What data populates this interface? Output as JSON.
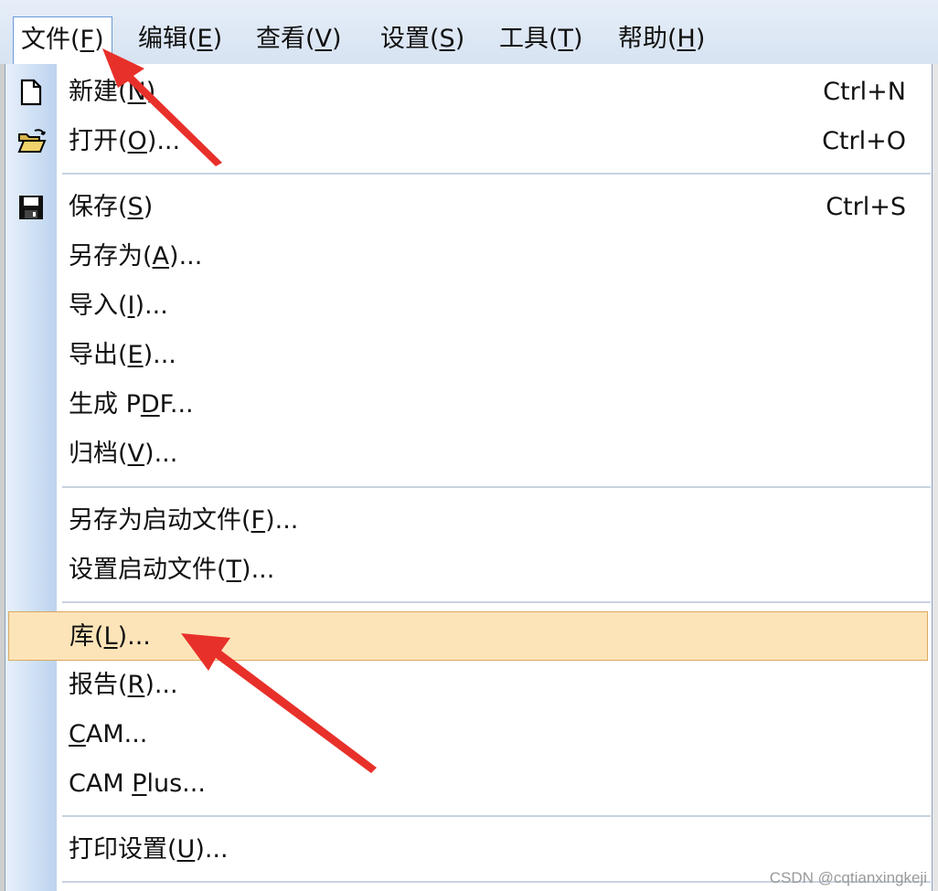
{
  "menubar": {
    "items": [
      {
        "label": "文件(",
        "key": "F",
        "tail": ")"
      },
      {
        "label": "编辑(",
        "key": "E",
        "tail": ")"
      },
      {
        "label": "查看(",
        "key": "V",
        "tail": ")"
      },
      {
        "label": "设置(",
        "key": "S",
        "tail": ")"
      },
      {
        "label": "工具(",
        "key": "T",
        "tail": ")"
      },
      {
        "label": "帮助(",
        "key": "H",
        "tail": ")"
      }
    ]
  },
  "file_menu": {
    "items": [
      {
        "label": "新建(",
        "key": "N",
        "tail": ")",
        "shortcut": "Ctrl+N",
        "icon": "new-document-icon"
      },
      {
        "label": "打开(",
        "key": "O",
        "tail": ")...",
        "shortcut": "Ctrl+O",
        "icon": "open-folder-icon"
      },
      {
        "label": "保存(",
        "key": "S",
        "tail": ")",
        "shortcut": "Ctrl+S",
        "icon": "save-disk-icon"
      },
      {
        "label": "另存为(",
        "key": "A",
        "tail": ")..."
      },
      {
        "label": "导入(",
        "key": "I",
        "tail": ")..."
      },
      {
        "label": "导出(",
        "key": "E",
        "tail": ")..."
      },
      {
        "label": "生成 P",
        "key": "D",
        "tail": "F..."
      },
      {
        "label": "归档(",
        "key": "V",
        "tail": ")..."
      },
      {
        "label": "另存为启动文件(",
        "key": "F",
        "tail": ")..."
      },
      {
        "label": "设置启动文件(",
        "key": "T",
        "tail": ")..."
      },
      {
        "label": "库(",
        "key": "L",
        "tail": ")..."
      },
      {
        "label": "报告(",
        "key": "R",
        "tail": ")..."
      },
      {
        "label": "",
        "key": "C",
        "tail": "AM..."
      },
      {
        "label": "CAM ",
        "key": "P",
        "tail": "lus..."
      },
      {
        "label": "打印设置(",
        "key": "U",
        "tail": ")..."
      }
    ]
  },
  "watermark": "CSDN @cqtianxingkeji",
  "colors": {
    "highlight": "#fde4b8",
    "arrow": "#e8302a",
    "menubar": "#d7e3f2"
  }
}
